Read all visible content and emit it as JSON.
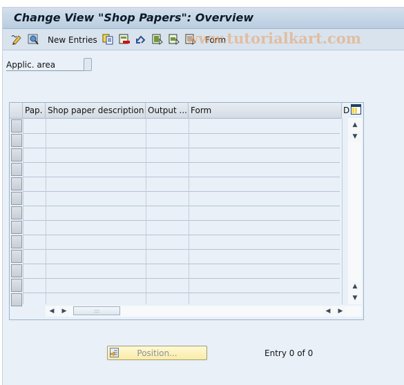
{
  "window": {
    "title": "Change View \"Shop Papers\": Overview",
    "watermark": "www.tutorialkart.com"
  },
  "toolbar": {
    "items": [
      {
        "icon": "display-change-icon",
        "label": ""
      },
      {
        "icon": "find-icon",
        "label": ""
      },
      {
        "icon": "",
        "label": "New Entries"
      },
      {
        "icon": "copy-as-icon",
        "label": ""
      },
      {
        "icon": "delete-icon",
        "label": ""
      },
      {
        "icon": "undo-change-icon",
        "label": ""
      },
      {
        "icon": "select-all-icon",
        "label": ""
      },
      {
        "icon": "select-block-icon",
        "label": ""
      },
      {
        "icon": "deselect-all-icon",
        "label": ""
      },
      {
        "icon": "",
        "label": "Form"
      }
    ],
    "new_entries_label": "New Entries",
    "form_label": "Form"
  },
  "selection": {
    "applic_area_label": "Applic. area",
    "applic_area_value": ""
  },
  "table": {
    "columns": [
      "Pap.",
      "Shop paper description",
      "Output ...",
      "Form",
      "D"
    ],
    "row_count_visible": 13,
    "rows": []
  },
  "footer": {
    "position_label": "Position...",
    "entry_text": "Entry 0 of 0"
  },
  "colors": {
    "background": "#e9f0f8",
    "titlebar": "#c6d7e8",
    "position_button": "#fbf0b6",
    "table_border": "#98b2cc"
  }
}
